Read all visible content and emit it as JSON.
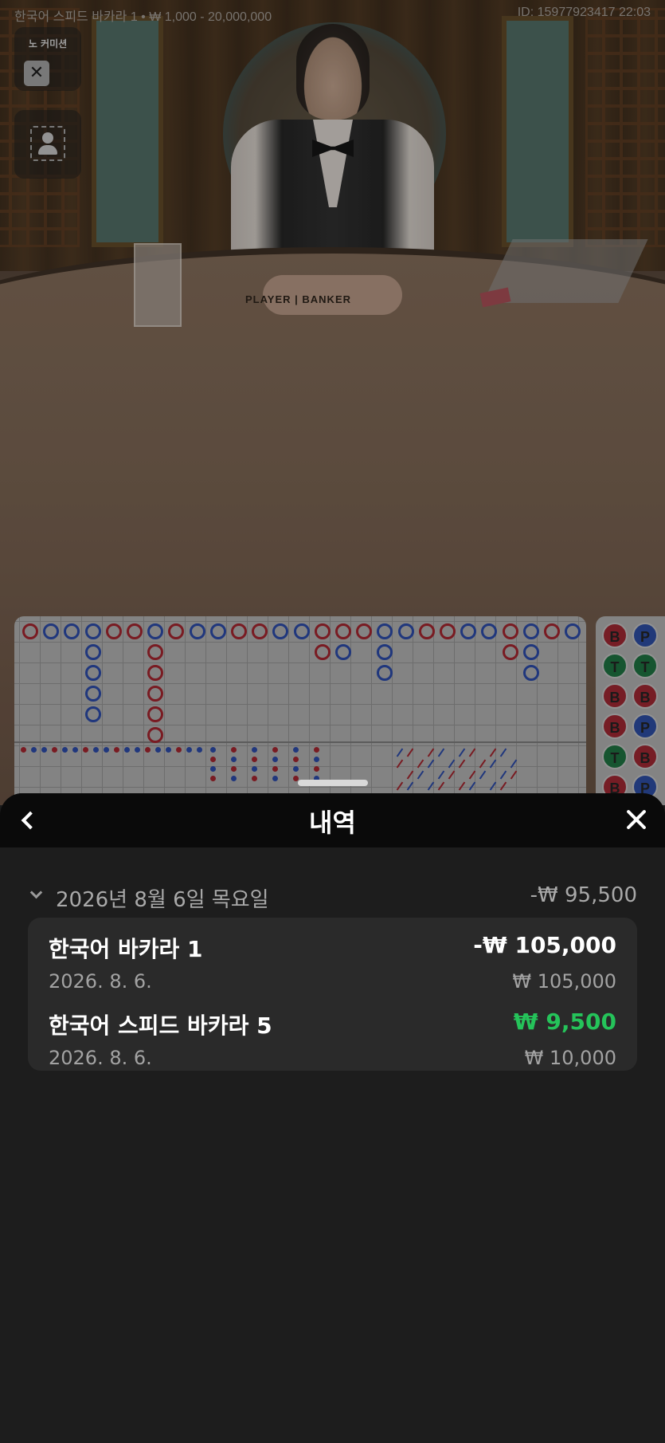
{
  "game_header": {
    "table_info": "한국어 스피드 바카라 1 • ₩ 1,000 - 20,000,000",
    "round_id": "ID: 15977923417 22:03"
  },
  "overlay_buttons": {
    "no_commission_label": "노 커미션"
  },
  "table_markings": {
    "player_banker": "PLAYER | BANKER"
  },
  "beadroad": [
    "B",
    "P",
    "T",
    "T",
    "B",
    "B",
    "B",
    "P",
    "T",
    "B",
    "B",
    "P"
  ],
  "history_sheet": {
    "title": "내역",
    "date_group": {
      "label": "2026년 8월 6일 목요일",
      "total": "-₩ 95,500"
    },
    "entries": [
      {
        "game": "한국어 바카라 1",
        "date": "2026. 8. 6.",
        "result": "-₩ 105,000",
        "stake": "₩ 105,000",
        "outcome": "loss"
      },
      {
        "game": "한국어 스피드 바카라 5",
        "date": "2026. 8. 6.",
        "result": "₩ 9,500",
        "stake": "₩ 10,000",
        "outcome": "win"
      }
    ]
  },
  "colors": {
    "win": "#25c35a",
    "banker": "#9c232c",
    "player": "#2a47a0",
    "tie": "#1d6e3e"
  }
}
